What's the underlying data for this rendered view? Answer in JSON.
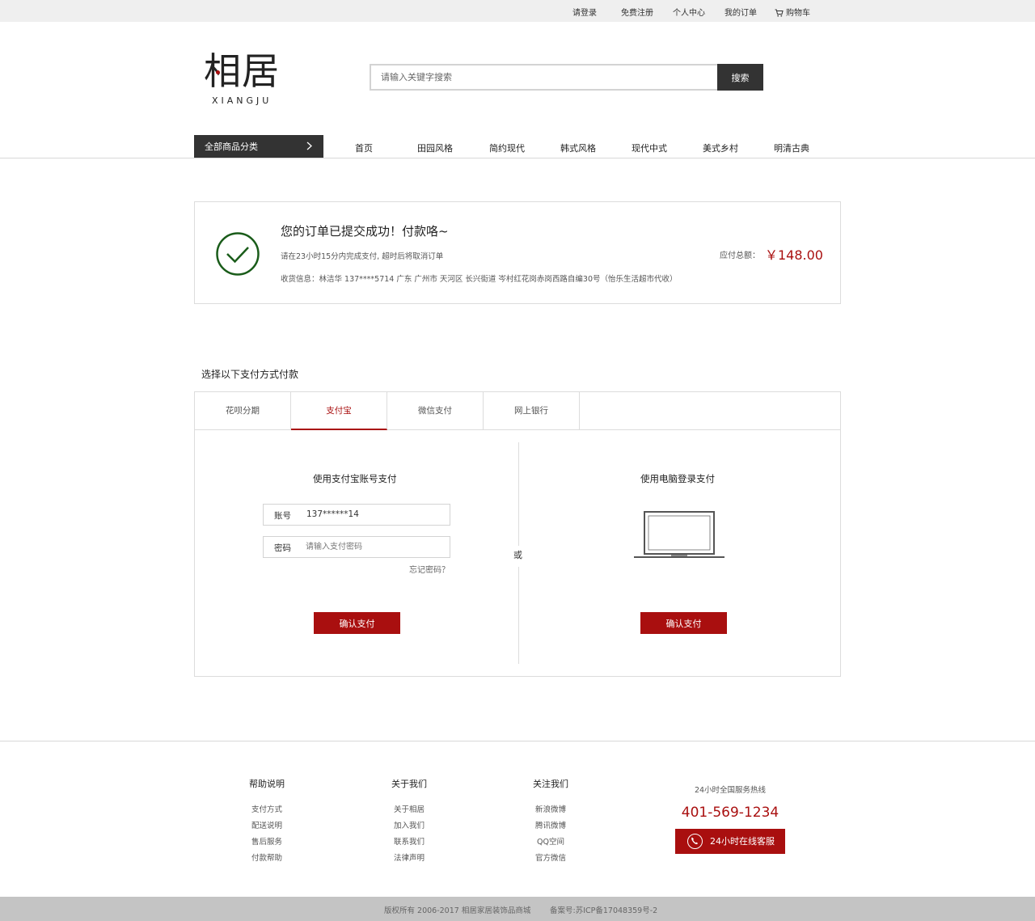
{
  "topbar": {
    "login": "请登录",
    "register": "免费注册",
    "personal_center": "个人中心",
    "my_orders": "我的订单",
    "cart": "购物车"
  },
  "logo": {
    "cn": "相居",
    "en": "XIANGJU"
  },
  "search": {
    "placeholder": "请输入关键字搜索",
    "button": "搜索"
  },
  "nav": {
    "category": "全部商品分类",
    "items": [
      "首页",
      "田园风格",
      "简约现代",
      "韩式风格",
      "现代中式",
      "美式乡村",
      "明清古典"
    ]
  },
  "order": {
    "title": "您的订单已提交成功！付款咯~",
    "deadline": "请在23小时15分内完成支付, 超时后将取消订单",
    "address": "收货信息：林洁华 137****5714    广东  广州市  天河区  长兴街道  岑村红花岗赤岗西路自编30号（怡乐生活超市代收）",
    "amount_label": "应付总额：",
    "amount": "￥148.00"
  },
  "payment": {
    "heading": "选择以下支付方式付款",
    "tabs": [
      "花呗分期",
      "支付宝",
      "微信支付",
      "网上银行"
    ],
    "active_tab": 1,
    "left": {
      "title": "使用支付宝账号支付",
      "account_label": "账号",
      "account_value": "137******14",
      "password_label": "密码",
      "password_placeholder": "请输入支付密码",
      "forgot": "忘记密码？",
      "confirm": "确认支付"
    },
    "or": "或",
    "right": {
      "title": "使用电脑登录支付",
      "confirm": "确认支付"
    }
  },
  "footer": {
    "columns": [
      {
        "title": "帮助说明",
        "links": [
          "支付方式",
          "配送说明",
          "售后服务",
          "付款帮助"
        ]
      },
      {
        "title": "关于我们",
        "links": [
          "关于相居",
          "加入我们",
          "联系我们",
          "法律声明"
        ]
      },
      {
        "title": "关注我们",
        "links": [
          "新浪微博",
          "腾讯微博",
          "QQ空间",
          "官方微信"
        ]
      }
    ],
    "hotline_label": "24小时全国服务热线",
    "hotline": "401-569-1234",
    "service_button": "24小时在线客服",
    "copyright": "版权所有 2006-2017 相居家居装饰品商城",
    "icp": "备案号:苏ICP备17048359号-2"
  },
  "colors": {
    "accent": "#a90f0f",
    "dark": "#333333",
    "success_green": "#1a5c1a"
  }
}
